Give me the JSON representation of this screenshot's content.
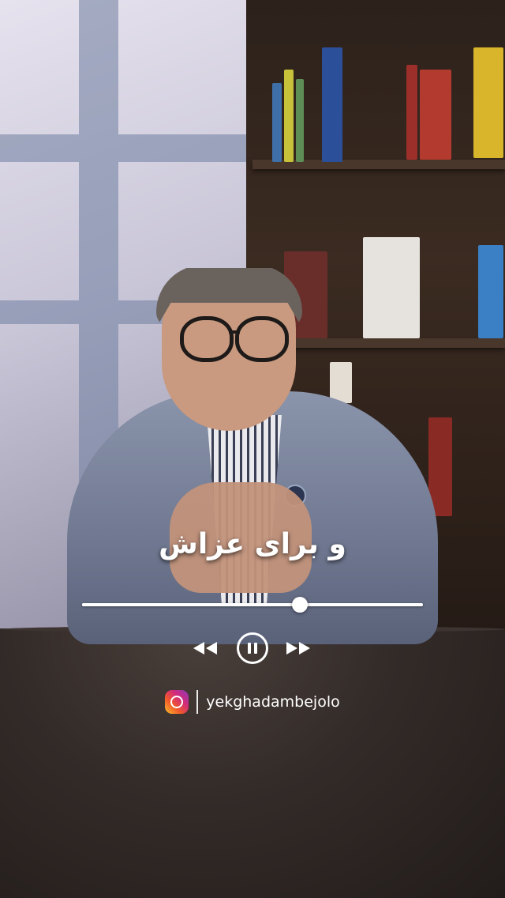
{
  "caption": {
    "text": "و برای عزاش"
  },
  "player": {
    "progress": 0.64,
    "controls": {
      "rewind_icon": "rewind-icon",
      "pause_icon": "pause-icon",
      "forward_icon": "fast-forward-icon"
    }
  },
  "social": {
    "icon": "instagram-icon",
    "handle": "yekghadambejolo"
  },
  "colors": {
    "overlay_text": "#ffffff",
    "ig_gradient": [
      "#f9c12c",
      "#f2592a",
      "#d22a7c",
      "#8a3ab9"
    ]
  }
}
